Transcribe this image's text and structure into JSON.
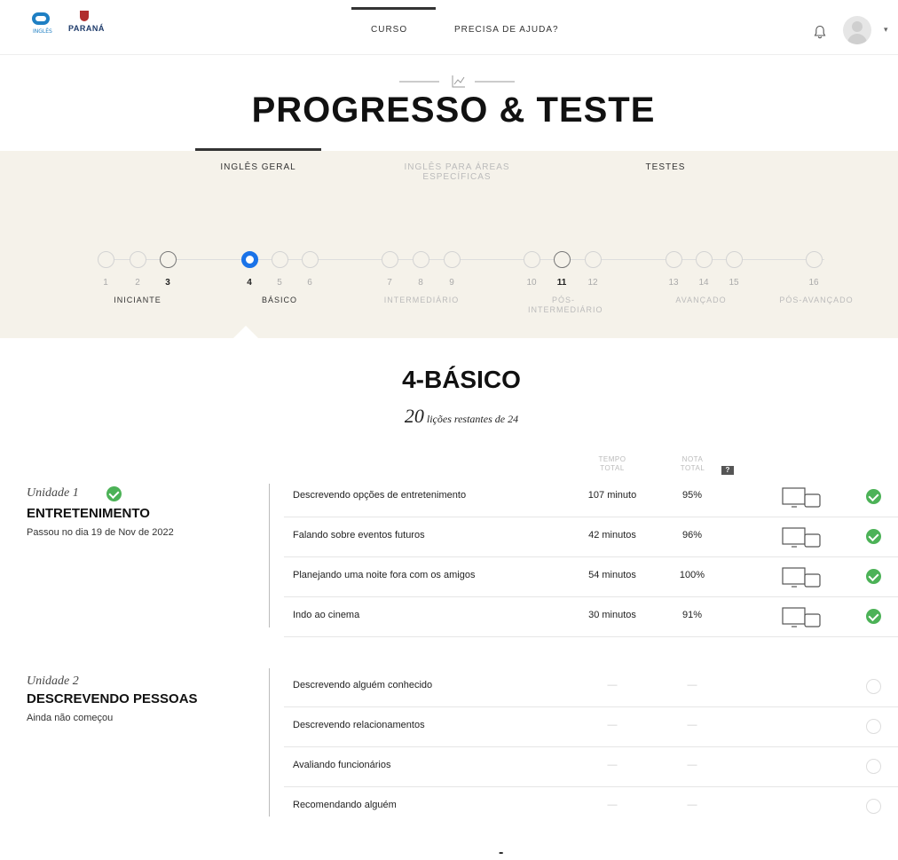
{
  "header": {
    "logo_sub": "INGLÊS",
    "logo_state": "PARANÁ",
    "nav": [
      "CURSO",
      "PRECISA DE AJUDA?"
    ],
    "caret": "▾"
  },
  "page_title": "PROGRESSO & TESTE",
  "tabs": [
    "INGLÊS GERAL",
    "INGLÊS PARA ÁREAS ESPECÍFICAS",
    "TESTES"
  ],
  "levels": {
    "numbers": [
      "1",
      "2",
      "3",
      "4",
      "5",
      "6",
      "7",
      "8",
      "9",
      "10",
      "11",
      "12",
      "13",
      "14",
      "15",
      "16"
    ],
    "names": [
      "INICIANTE",
      "BÁSICO",
      "INTERMEDIÁRIO",
      "PÓS-INTERMEDIÁRIO",
      "AVANÇADO",
      "PÓS-AVANÇADO"
    ],
    "current": "4"
  },
  "section": {
    "title": "4-BÁSICO",
    "remaining": "20",
    "remaining_text": " lições restantes de 24"
  },
  "columns": {
    "time": "TEMPO TOTAL",
    "grade": "NOTA TOTAL",
    "help": "?"
  },
  "units": [
    {
      "label": "Unidade 1",
      "name": "ENTRETENIMENTO",
      "status": "Passou no dia 19 de Nov de 2022",
      "lessons": [
        {
          "title": "Descrevendo opções de entretenimento",
          "time": "107 minuto",
          "grade": "95%"
        },
        {
          "title": "Falando sobre eventos futuros",
          "time": "42 minutos",
          "grade": "96%"
        },
        {
          "title": "Planejando uma noite fora com os amigos",
          "time": "54 minutos",
          "grade": "100%"
        },
        {
          "title": "Indo ao cinema",
          "time": "30 minutos",
          "grade": "91%"
        }
      ]
    },
    {
      "label": "Unidade 2",
      "name": "DESCREVENDO PESSOAS",
      "status": "Ainda não começou",
      "lessons": [
        {
          "title": "Descrevendo alguém conhecido",
          "time": "—",
          "grade": "—"
        },
        {
          "title": "Descrevendo relacionamentos",
          "time": "—",
          "grade": "—"
        },
        {
          "title": "Avaliando funcionários",
          "time": "—",
          "grade": "—"
        },
        {
          "title": "Recomendando alguém",
          "time": "—",
          "grade": "—"
        }
      ]
    }
  ],
  "bottom_mark": "-",
  "colors": {
    "accent": "#1a73e8",
    "success": "#4cb257",
    "band": "#f5f2ea"
  }
}
